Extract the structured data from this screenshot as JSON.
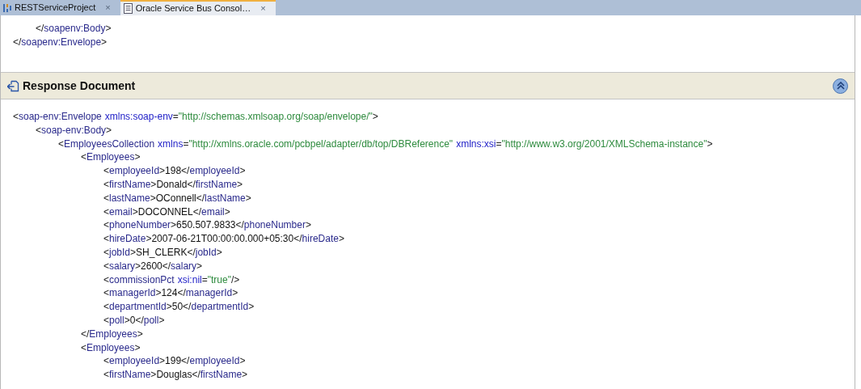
{
  "tabs": [
    {
      "label": "RESTServiceProject",
      "selected": false,
      "close": "×"
    },
    {
      "label": "Oracle Service Bus Consol…",
      "selected": true,
      "close": "×"
    }
  ],
  "request_tail": [
    {
      "children": [
        {
          "segments": [
            {
              "kind": "punct",
              "text": "</"
            },
            {
              "kind": "tag",
              "text": "soapenv:Body"
            },
            {
              "kind": "punct",
              "text": ">"
            }
          ]
        }
      ]
    },
    {
      "segments": [
        {
          "kind": "punct",
          "text": "</"
        },
        {
          "kind": "tag",
          "text": "soapenv:Envelope"
        },
        {
          "kind": "punct",
          "text": ">"
        }
      ]
    }
  ],
  "response": {
    "title": "Response Document",
    "lines": [
      {
        "segments": [
          {
            "kind": "punct",
            "text": "<"
          },
          {
            "kind": "tag",
            "text": "soap-env:Envelope"
          },
          {
            "kind": "attr",
            "text": "xmlns:soap-env"
          },
          {
            "kind": "punct",
            "text": "="
          },
          {
            "kind": "value",
            "text": "\"http://schemas.xmlsoap.org/soap/envelope/\""
          },
          {
            "kind": "punct",
            "text": ">"
          }
        ],
        "children": [
          {
            "segments": [
              {
                "kind": "punct",
                "text": "<"
              },
              {
                "kind": "tag",
                "text": "soap-env:Body"
              },
              {
                "kind": "punct",
                "text": ">"
              }
            ],
            "children": [
              {
                "segments": [
                  {
                    "kind": "punct",
                    "text": "<"
                  },
                  {
                    "kind": "tag",
                    "text": "EmployeesCollection"
                  },
                  {
                    "kind": "attr",
                    "text": "xmlns"
                  },
                  {
                    "kind": "punct",
                    "text": "="
                  },
                  {
                    "kind": "value",
                    "text": "\"http://xmlns.oracle.com/pcbpel/adapter/db/top/DBReference\""
                  },
                  {
                    "kind": "attr",
                    "text": "xmlns:xsi"
                  },
                  {
                    "kind": "punct",
                    "text": "="
                  },
                  {
                    "kind": "value",
                    "text": "\"http://www.w3.org/2001/XMLSchema-instance\""
                  },
                  {
                    "kind": "punct",
                    "text": ">"
                  }
                ],
                "children": [
                  {
                    "segments": [
                      {
                        "kind": "punct",
                        "text": "<"
                      },
                      {
                        "kind": "tag",
                        "text": "Employees"
                      },
                      {
                        "kind": "punct",
                        "text": ">"
                      }
                    ],
                    "children": [
                      {
                        "segments": [
                          {
                            "kind": "punct",
                            "text": "<"
                          },
                          {
                            "kind": "tag",
                            "text": "employeeId"
                          },
                          {
                            "kind": "punct",
                            "text": ">"
                          },
                          {
                            "kind": "text",
                            "text": "198"
                          },
                          {
                            "kind": "punct",
                            "text": "</"
                          },
                          {
                            "kind": "tag",
                            "text": "employeeId"
                          },
                          {
                            "kind": "punct",
                            "text": ">"
                          }
                        ]
                      },
                      {
                        "segments": [
                          {
                            "kind": "punct",
                            "text": "<"
                          },
                          {
                            "kind": "tag",
                            "text": "firstName"
                          },
                          {
                            "kind": "punct",
                            "text": ">"
                          },
                          {
                            "kind": "text",
                            "text": "Donald"
                          },
                          {
                            "kind": "punct",
                            "text": "</"
                          },
                          {
                            "kind": "tag",
                            "text": "firstName"
                          },
                          {
                            "kind": "punct",
                            "text": ">"
                          }
                        ]
                      },
                      {
                        "segments": [
                          {
                            "kind": "punct",
                            "text": "<"
                          },
                          {
                            "kind": "tag",
                            "text": "lastName"
                          },
                          {
                            "kind": "punct",
                            "text": ">"
                          },
                          {
                            "kind": "text",
                            "text": "OConnell"
                          },
                          {
                            "kind": "punct",
                            "text": "</"
                          },
                          {
                            "kind": "tag",
                            "text": "lastName"
                          },
                          {
                            "kind": "punct",
                            "text": ">"
                          }
                        ]
                      },
                      {
                        "segments": [
                          {
                            "kind": "punct",
                            "text": "<"
                          },
                          {
                            "kind": "tag",
                            "text": "email"
                          },
                          {
                            "kind": "punct",
                            "text": ">"
                          },
                          {
                            "kind": "text",
                            "text": "DOCONNEL"
                          },
                          {
                            "kind": "punct",
                            "text": "</"
                          },
                          {
                            "kind": "tag",
                            "text": "email"
                          },
                          {
                            "kind": "punct",
                            "text": ">"
                          }
                        ]
                      },
                      {
                        "segments": [
                          {
                            "kind": "punct",
                            "text": "<"
                          },
                          {
                            "kind": "tag",
                            "text": "phoneNumber"
                          },
                          {
                            "kind": "punct",
                            "text": ">"
                          },
                          {
                            "kind": "text",
                            "text": "650.507.9833"
                          },
                          {
                            "kind": "punct",
                            "text": "</"
                          },
                          {
                            "kind": "tag",
                            "text": "phoneNumber"
                          },
                          {
                            "kind": "punct",
                            "text": ">"
                          }
                        ]
                      },
                      {
                        "segments": [
                          {
                            "kind": "punct",
                            "text": "<"
                          },
                          {
                            "kind": "tag",
                            "text": "hireDate"
                          },
                          {
                            "kind": "punct",
                            "text": ">"
                          },
                          {
                            "kind": "text",
                            "text": "2007-06-21T00:00:00.000+05:30"
                          },
                          {
                            "kind": "punct",
                            "text": "</"
                          },
                          {
                            "kind": "tag",
                            "text": "hireDate"
                          },
                          {
                            "kind": "punct",
                            "text": ">"
                          }
                        ]
                      },
                      {
                        "segments": [
                          {
                            "kind": "punct",
                            "text": "<"
                          },
                          {
                            "kind": "tag",
                            "text": "jobId"
                          },
                          {
                            "kind": "punct",
                            "text": ">"
                          },
                          {
                            "kind": "text",
                            "text": "SH_CLERK"
                          },
                          {
                            "kind": "punct",
                            "text": "</"
                          },
                          {
                            "kind": "tag",
                            "text": "jobId"
                          },
                          {
                            "kind": "punct",
                            "text": ">"
                          }
                        ]
                      },
                      {
                        "segments": [
                          {
                            "kind": "punct",
                            "text": "<"
                          },
                          {
                            "kind": "tag",
                            "text": "salary"
                          },
                          {
                            "kind": "punct",
                            "text": ">"
                          },
                          {
                            "kind": "text",
                            "text": "2600"
                          },
                          {
                            "kind": "punct",
                            "text": "</"
                          },
                          {
                            "kind": "tag",
                            "text": "salary"
                          },
                          {
                            "kind": "punct",
                            "text": ">"
                          }
                        ]
                      },
                      {
                        "segments": [
                          {
                            "kind": "punct",
                            "text": "<"
                          },
                          {
                            "kind": "tag",
                            "text": "commissionPct"
                          },
                          {
                            "kind": "attr",
                            "text": "xsi:nil"
                          },
                          {
                            "kind": "punct",
                            "text": "="
                          },
                          {
                            "kind": "value",
                            "text": "\"true\""
                          },
                          {
                            "kind": "punct",
                            "text": "/>"
                          }
                        ]
                      },
                      {
                        "segments": [
                          {
                            "kind": "punct",
                            "text": "<"
                          },
                          {
                            "kind": "tag",
                            "text": "managerId"
                          },
                          {
                            "kind": "punct",
                            "text": ">"
                          },
                          {
                            "kind": "text",
                            "text": "124"
                          },
                          {
                            "kind": "punct",
                            "text": "</"
                          },
                          {
                            "kind": "tag",
                            "text": "managerId"
                          },
                          {
                            "kind": "punct",
                            "text": ">"
                          }
                        ]
                      },
                      {
                        "segments": [
                          {
                            "kind": "punct",
                            "text": "<"
                          },
                          {
                            "kind": "tag",
                            "text": "departmentId"
                          },
                          {
                            "kind": "punct",
                            "text": ">"
                          },
                          {
                            "kind": "text",
                            "text": "50"
                          },
                          {
                            "kind": "punct",
                            "text": "</"
                          },
                          {
                            "kind": "tag",
                            "text": "departmentId"
                          },
                          {
                            "kind": "punct",
                            "text": ">"
                          }
                        ]
                      },
                      {
                        "segments": [
                          {
                            "kind": "punct",
                            "text": "<"
                          },
                          {
                            "kind": "tag",
                            "text": "poll"
                          },
                          {
                            "kind": "punct",
                            "text": ">"
                          },
                          {
                            "kind": "text",
                            "text": "0"
                          },
                          {
                            "kind": "punct",
                            "text": "</"
                          },
                          {
                            "kind": "tag",
                            "text": "poll"
                          },
                          {
                            "kind": "punct",
                            "text": ">"
                          }
                        ]
                      }
                    ]
                  },
                  {
                    "segments": [
                      {
                        "kind": "punct",
                        "text": "</"
                      },
                      {
                        "kind": "tag",
                        "text": "Employees"
                      },
                      {
                        "kind": "punct",
                        "text": ">"
                      }
                    ]
                  },
                  {
                    "segments": [
                      {
                        "kind": "punct",
                        "text": "<"
                      },
                      {
                        "kind": "tag",
                        "text": "Employees"
                      },
                      {
                        "kind": "punct",
                        "text": ">"
                      }
                    ],
                    "children": [
                      {
                        "segments": [
                          {
                            "kind": "punct",
                            "text": "<"
                          },
                          {
                            "kind": "tag",
                            "text": "employeeId"
                          },
                          {
                            "kind": "punct",
                            "text": ">"
                          },
                          {
                            "kind": "text",
                            "text": "199"
                          },
                          {
                            "kind": "punct",
                            "text": "</"
                          },
                          {
                            "kind": "tag",
                            "text": "employeeId"
                          },
                          {
                            "kind": "punct",
                            "text": ">"
                          }
                        ]
                      },
                      {
                        "segments": [
                          {
                            "kind": "punct",
                            "text": "<"
                          },
                          {
                            "kind": "tag",
                            "text": "firstName"
                          },
                          {
                            "kind": "punct",
                            "text": ">"
                          },
                          {
                            "kind": "text",
                            "text": "Douglas"
                          },
                          {
                            "kind": "punct",
                            "text": "</"
                          },
                          {
                            "kind": "tag",
                            "text": "firstName"
                          },
                          {
                            "kind": "punct",
                            "text": ">"
                          }
                        ]
                      }
                    ]
                  }
                ]
              }
            ]
          }
        ]
      }
    ]
  }
}
